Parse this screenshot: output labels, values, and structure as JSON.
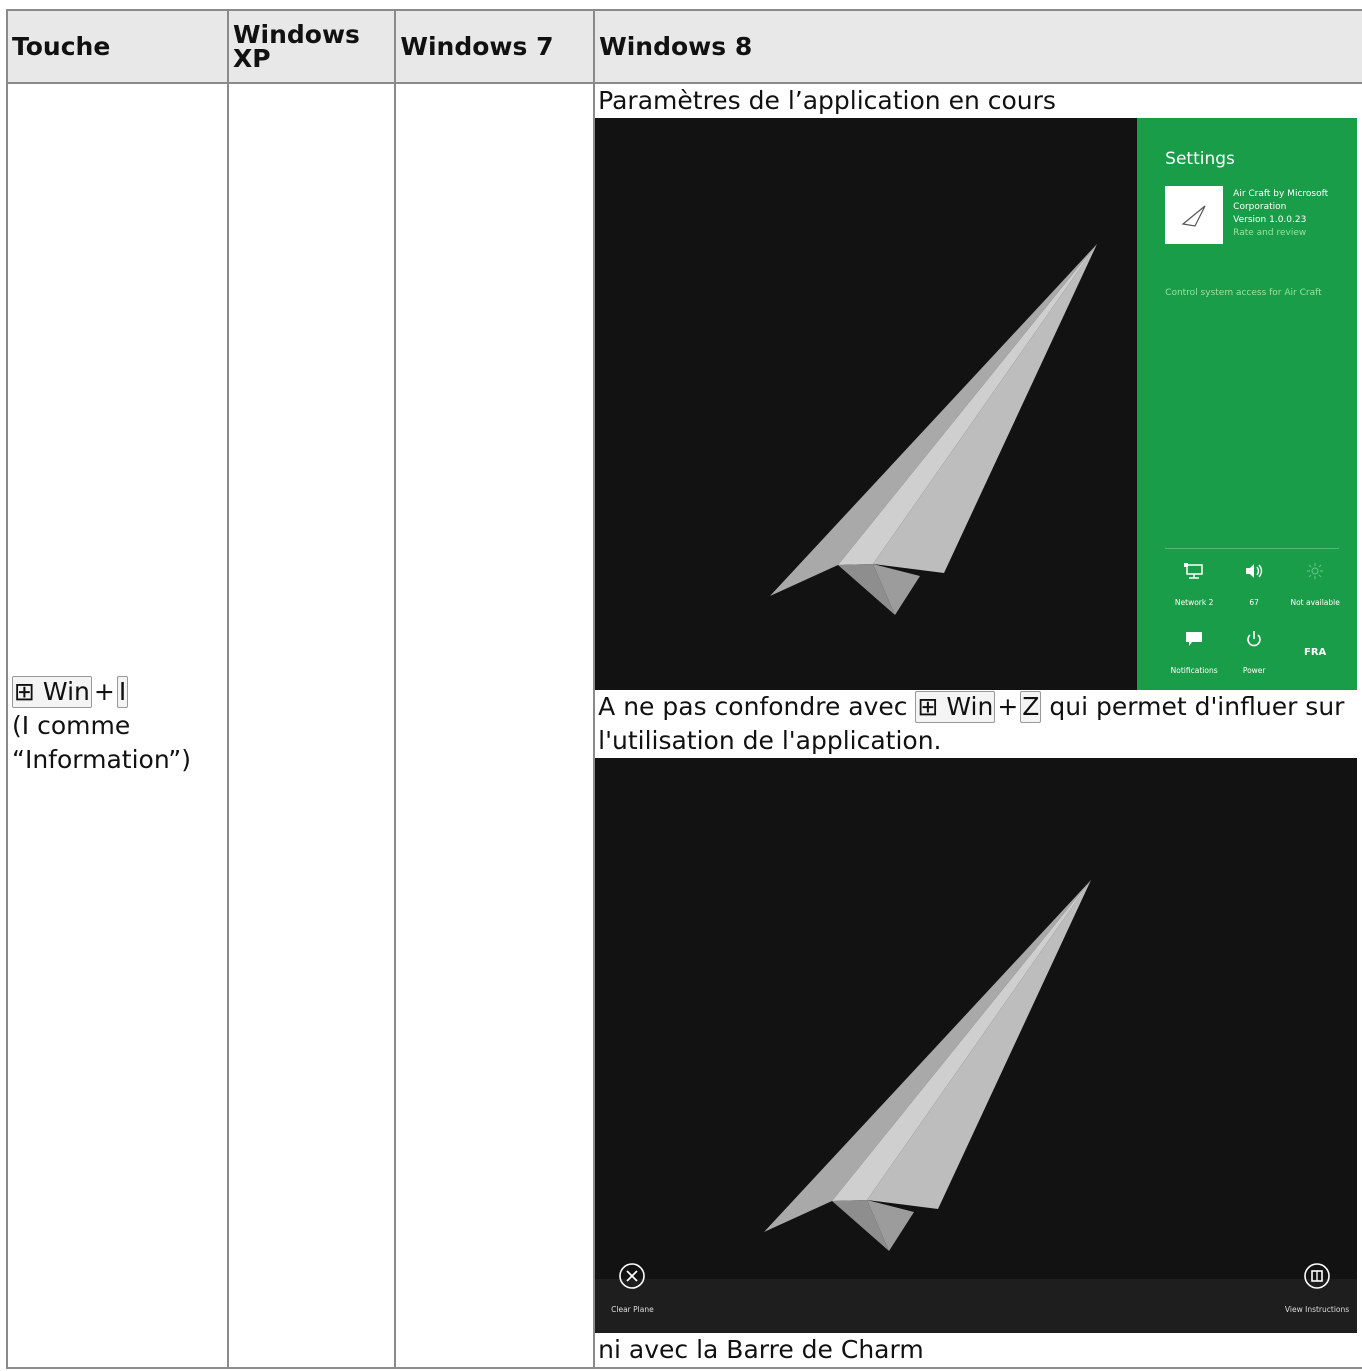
{
  "table": {
    "headers": [
      "Touche",
      "Windows XP",
      "Windows 7",
      "Windows 8"
    ],
    "row": {
      "key": "⊞ Win",
      "plus": "+",
      "letter": "I",
      "note": "(I comme “Information”)",
      "xp": "",
      "w7": "",
      "w8": {
        "caption1": "Paramètres de l’application en cours",
        "caption2_a": "A ne pas confondre avec",
        "caption2_key": "⊞ Win",
        "caption2_plus": "+",
        "caption2_letter": "Z",
        "caption2_b": "qui permet d'influer sur l'utilisation de l'application.",
        "caption3": "ni avec la Barre de Charm"
      }
    }
  },
  "screenshot_settings": {
    "title": "Settings",
    "app_name_1": "Air Craft by Microsoft",
    "app_name_2": "Corporation",
    "version": "Version 1.0.0.23",
    "rate_link": "Rate and review",
    "control_link": "Control system access for Air Craft",
    "network_label": "Network 2",
    "volume_label": "67",
    "brightness_label": "Not available",
    "notifications_label": "Notifications",
    "power_label": "Power",
    "language_label": "FRA",
    "panel_color": "#1a9d49"
  },
  "screenshot_appbar": {
    "clear_label": "Clear Plane",
    "instructions_label": "View Instructions"
  }
}
